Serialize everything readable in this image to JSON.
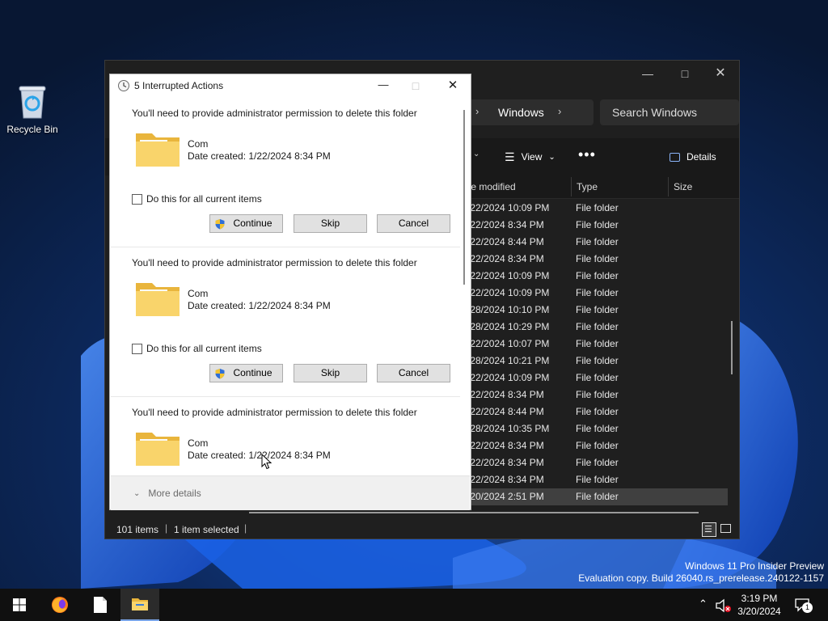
{
  "desktop": {
    "recycle_bin_label": "Recycle Bin",
    "watermark_line1": "Windows 11 Pro Insider Preview",
    "watermark_line2": "Evaluation copy. Build 26040.rs_prerelease.240122-1157"
  },
  "explorer": {
    "address_segment": "Windows",
    "search_placeholder": "Search Windows",
    "view_label": "View",
    "details_label": "Details",
    "columns": {
      "date": "te modified",
      "type": "Type",
      "size": "Size"
    },
    "rows": [
      {
        "date": "/22/2024 10:09 PM",
        "type": "File folder"
      },
      {
        "date": "/22/2024 8:34 PM",
        "type": "File folder"
      },
      {
        "date": "/22/2024 8:44 PM",
        "type": "File folder"
      },
      {
        "date": "/22/2024 8:34 PM",
        "type": "File folder"
      },
      {
        "date": "/22/2024 10:09 PM",
        "type": "File folder"
      },
      {
        "date": "/22/2024 10:09 PM",
        "type": "File folder"
      },
      {
        "date": "/28/2024 10:10 PM",
        "type": "File folder"
      },
      {
        "date": "/28/2024 10:29 PM",
        "type": "File folder"
      },
      {
        "date": "/22/2024 10:07 PM",
        "type": "File folder"
      },
      {
        "date": "/28/2024 10:21 PM",
        "type": "File folder"
      },
      {
        "date": "/22/2024 10:09 PM",
        "type": "File folder"
      },
      {
        "date": "/22/2024 8:34 PM",
        "type": "File folder"
      },
      {
        "date": "/22/2024 8:44 PM",
        "type": "File folder"
      },
      {
        "date": "/28/2024 10:35 PM",
        "type": "File folder"
      },
      {
        "date": "/22/2024 8:34 PM",
        "type": "File folder"
      },
      {
        "date": "/22/2024 8:34 PM",
        "type": "File folder"
      },
      {
        "date": "/22/2024 8:34 PM",
        "type": "File folder"
      },
      {
        "date": "/20/2024 2:51 PM",
        "type": "File folder"
      }
    ],
    "status_items": "101 items",
    "status_selected": "1 item selected"
  },
  "dialog": {
    "title": "5 Interrupted Actions",
    "items": [
      {
        "message": "You'll need to provide administrator permission to delete this folder",
        "folder_name": "Com",
        "date_created": "Date created: 1/22/2024 8:34 PM",
        "checkbox_label": "Do this for all current items",
        "continue": "Continue",
        "skip": "Skip",
        "cancel": "Cancel"
      },
      {
        "message": "You'll need to provide administrator permission to delete this folder",
        "folder_name": "Com",
        "date_created": "Date created: 1/22/2024 8:34 PM",
        "checkbox_label": "Do this for all current items",
        "continue": "Continue",
        "skip": "Skip",
        "cancel": "Cancel"
      },
      {
        "message": "You'll need to provide administrator permission to delete this folder",
        "folder_name": "Com",
        "date_created": "Date created: 1/22/2024 8:34 PM"
      }
    ],
    "more_details": "More details"
  },
  "taskbar": {
    "time": "3:19 PM",
    "date": "3/20/2024",
    "notification_count": "1"
  },
  "colors": {
    "accent": "#7aa5e8",
    "folder_yellow": "#f7c948",
    "shield_blue": "#2f6fd8",
    "shield_yellow": "#f4c430"
  }
}
